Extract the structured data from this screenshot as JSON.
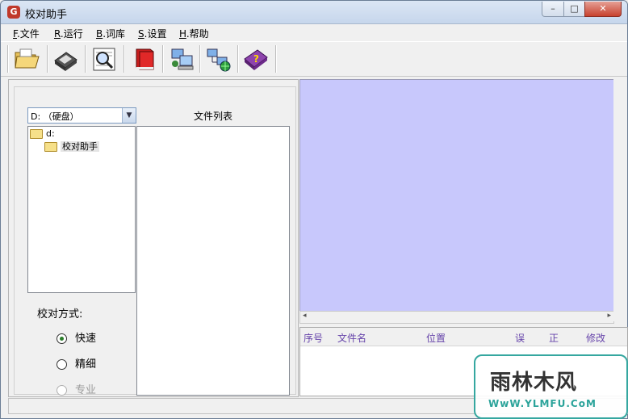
{
  "window": {
    "title": "校对助手",
    "app_icon_letter": "G"
  },
  "menu": [
    {
      "accel": "F",
      "label": ".文件"
    },
    {
      "accel": "R",
      "label": ".运行"
    },
    {
      "accel": "B",
      "label": ".词库"
    },
    {
      "accel": "S",
      "label": ".设置"
    },
    {
      "accel": "H",
      "label": ".帮助"
    }
  ],
  "toolbar": [
    {
      "icon": "open-folder-icon"
    },
    {
      "icon": "save-disk-icon"
    },
    {
      "icon": "proofread-magnifier-icon"
    },
    {
      "icon": "dictionary-book-icon"
    },
    {
      "icon": "network-computer-icon"
    },
    {
      "icon": "network-globe-icon"
    },
    {
      "icon": "help-book-icon"
    }
  ],
  "left": {
    "drive_value": "D: （硬盘）",
    "file_list_label": "文件列表",
    "tree": [
      {
        "label": "d:"
      },
      {
        "label": "校对助手"
      }
    ],
    "method_label": "校对方式:",
    "methods": [
      {
        "label": "快速",
        "checked": true,
        "enabled": true
      },
      {
        "label": "精细",
        "checked": false,
        "enabled": true
      },
      {
        "label": "专业",
        "checked": false,
        "enabled": false
      }
    ]
  },
  "results": {
    "columns": [
      "序号",
      "文件名",
      "位置",
      "误",
      "正",
      "修改"
    ]
  },
  "watermark": {
    "main": "雨林木风",
    "sub": "WwW.YLMFU.CoM"
  },
  "colors": {
    "preview_bg": "#c8c8fc",
    "column_text": "#6644aa",
    "watermark_teal": "#35a7a0"
  }
}
